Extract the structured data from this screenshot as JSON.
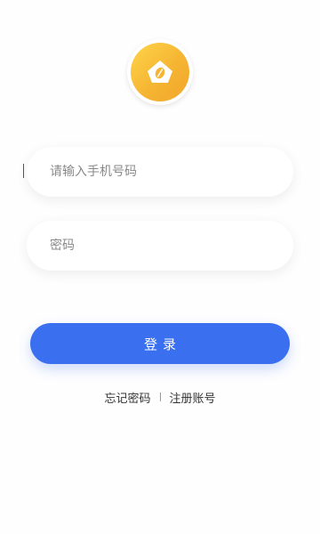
{
  "logo": {
    "icon": "app-logo-icon",
    "gradient_start": "#ffd54a",
    "gradient_end": "#f3a62a"
  },
  "form": {
    "phone_placeholder": "请输入手机号码",
    "phone_value": "",
    "password_placeholder": "密码",
    "password_value": ""
  },
  "login_button": {
    "label": "登录",
    "color": "#3a6ff0"
  },
  "links": {
    "forgot_password": "忘记密码",
    "register": "注册账号"
  }
}
